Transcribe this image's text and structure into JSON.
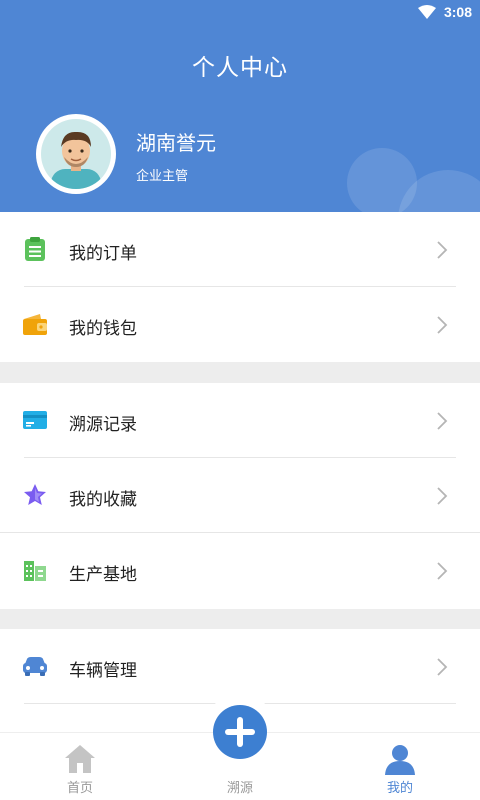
{
  "status_bar": {
    "time": "3:08"
  },
  "header": {
    "title": "个人中心"
  },
  "profile": {
    "name": "湖南誉元",
    "role": "企业主管"
  },
  "menu_groups": [
    [
      {
        "label": "我的订单",
        "icon": "order-icon",
        "color": "#5cc25c"
      },
      {
        "label": "我的钱包",
        "icon": "wallet-icon",
        "color": "#f0a30a"
      }
    ],
    [
      {
        "label": "溯源记录",
        "icon": "card-icon",
        "color": "#21aee6"
      },
      {
        "label": "我的收藏",
        "icon": "star-icon",
        "color": "#7a5cf0"
      },
      {
        "label": "生产基地",
        "icon": "building-icon",
        "color": "#5cc25c"
      }
    ],
    [
      {
        "label": "车辆管理",
        "icon": "car-icon",
        "color": "#4f86d4"
      }
    ]
  ],
  "tabbar": {
    "tabs": [
      {
        "label": "首页",
        "icon": "home-icon",
        "active": false
      },
      {
        "label": "溯源",
        "icon": "plus-icon",
        "active": false
      },
      {
        "label": "我的",
        "icon": "user-icon",
        "active": true
      }
    ]
  },
  "colors": {
    "primary": "#4f86d4",
    "tab_inactive": "#999999",
    "background": "#ededed"
  }
}
